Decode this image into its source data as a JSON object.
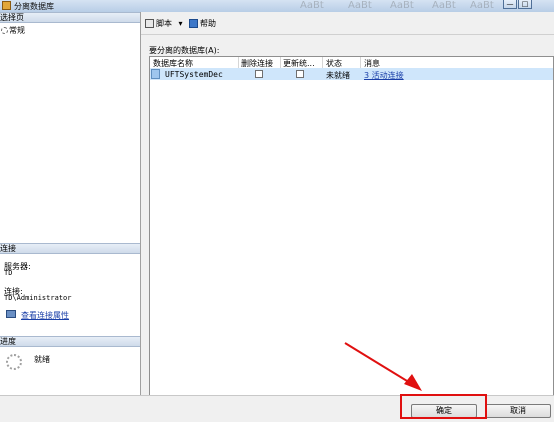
{
  "window": {
    "title": "分离数据库",
    "controls": [
      "—",
      "□"
    ]
  },
  "background_strip": [
    "AaBt",
    "AaBt",
    "AaBt",
    "AaBt",
    "AaBt"
  ],
  "left": {
    "select_page_header": "选择页",
    "pages": [
      "常规"
    ],
    "connection_header": "连接",
    "server_label": "服务器:",
    "server_value": "TD",
    "connection_label": "连接:",
    "connection_value": "TD\\Administrator",
    "view_props_link": "查看连接属性",
    "progress_header": "进度",
    "progress_status": "就绪"
  },
  "toolbar": {
    "script_label": "脚本",
    "help_label": "帮助"
  },
  "main": {
    "databases_label": "要分离的数据库(A):",
    "columns": [
      "数据库名称",
      "删除连接",
      "更新统...",
      "状态",
      "消息"
    ],
    "rows": [
      {
        "name": "UFTSystemDec",
        "drop_connections": false,
        "update_stats": false,
        "status": "未就绪",
        "message": "3 活动连接"
      }
    ]
  },
  "footer": {
    "ok_label": "确定",
    "cancel_label": "取消"
  },
  "colors": {
    "highlight": "#e01010",
    "selected_row": "#cfe6fb",
    "link": "#1a3fa8"
  }
}
